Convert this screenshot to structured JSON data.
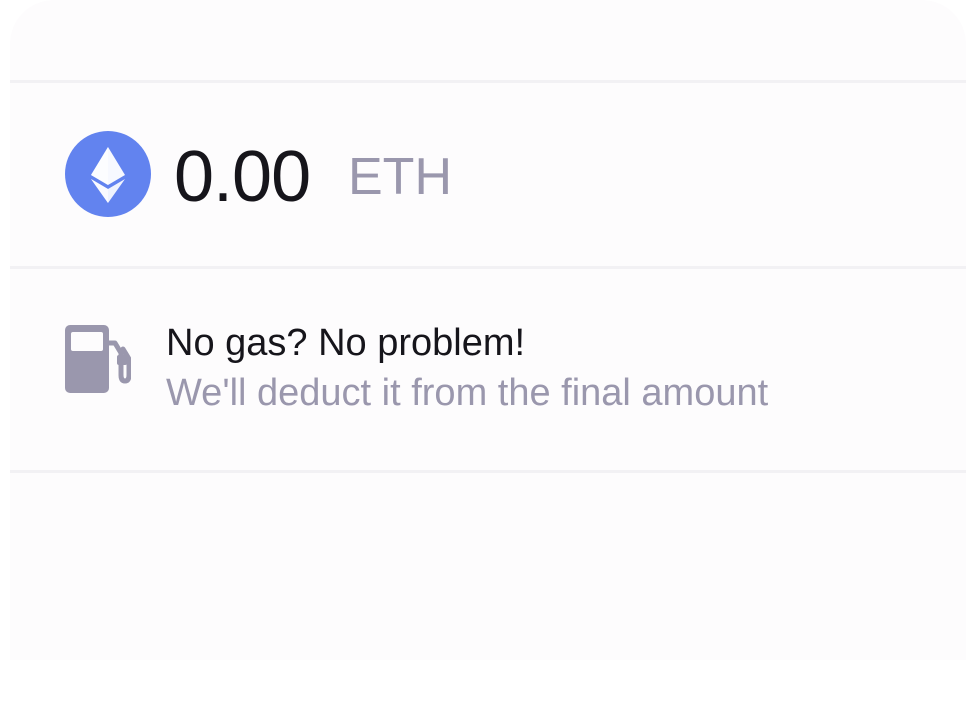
{
  "balance": {
    "amount": "0.00",
    "unit": "ETH",
    "token_icon": "ethereum-icon",
    "token_color": "#6283ef"
  },
  "gas_notice": {
    "icon": "gas-pump-icon",
    "title": "No gas? No problem!",
    "subtitle": "We'll deduct it from the final amount"
  },
  "colors": {
    "primary_text": "#16151b",
    "secondary_text": "#9a97ad",
    "card_background": "#fdfcfd",
    "divider": "#f2f1f4"
  }
}
